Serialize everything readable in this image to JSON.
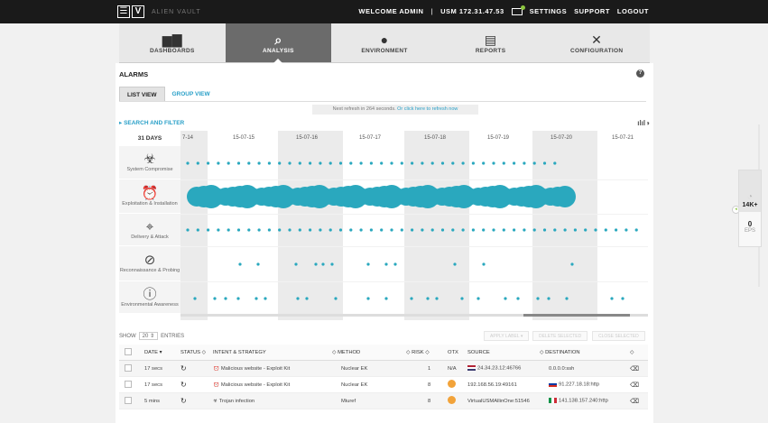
{
  "app": {
    "logo_text": "V",
    "brand": "ALIEN VAULT",
    "welcome": "WELCOME ADMIN",
    "separator": "|",
    "usm": "USM 172.31.47.53",
    "links": [
      "SETTINGS",
      "SUPPORT",
      "LOGOUT"
    ]
  },
  "mainnav": [
    {
      "label": "DASHBOARDS",
      "icon": "bar-chart-icon",
      "glyph": "▆▇"
    },
    {
      "label": "ANALYSIS",
      "icon": "magnify-icon",
      "glyph": "⌕",
      "active": true
    },
    {
      "label": "ENVIRONMENT",
      "icon": "planet-icon",
      "glyph": "●"
    },
    {
      "label": "REPORTS",
      "icon": "document-icon",
      "glyph": "▤"
    },
    {
      "label": "CONFIGURATION",
      "icon": "tools-icon",
      "glyph": "✕"
    }
  ],
  "page": {
    "title": "ALARMS",
    "help": "?",
    "tabs": [
      "LIST VIEW",
      "GROUP VIEW"
    ],
    "refresh_text": "Next refresh in 264 seconds.",
    "refresh_link": "Or click here to refresh now",
    "search_filter": "▸ SEARCH AND FILTER",
    "chart_icon": "ılıl◑"
  },
  "timeline": {
    "days": "31 DAYS",
    "dates": [
      "7-14",
      "15-07-15",
      "15-07-16",
      "15-07-17",
      "15-07-18",
      "15-07-19",
      "15-07-20",
      "15-07-21"
    ],
    "categories": [
      {
        "label": "System Compromise",
        "icon": "biohazard-icon",
        "glyph": "☣"
      },
      {
        "label": "Exploitation & Installation",
        "icon": "alarm-clock-icon",
        "glyph": "⏰"
      },
      {
        "label": "Delivery & Attack",
        "icon": "crosshair-icon",
        "glyph": "⌖"
      },
      {
        "label": "Reconnaissance & Probing",
        "icon": "compass-icon",
        "glyph": "⊘"
      },
      {
        "label": "Environmental Awareness",
        "icon": "info-icon",
        "glyph": "ⓘ"
      }
    ],
    "dot_color": "#2aa8be"
  },
  "table": {
    "show_label": "SHOW",
    "show_value": "20",
    "entries_label": "ENTRIES",
    "actions": [
      "APPLY LABEL",
      "DELETE SELECTED",
      "CLOSE SELECTED"
    ],
    "headers": [
      "DATE",
      "STATUS",
      "INTENT & STRATEGY",
      "METHOD",
      "RISK",
      "OTX",
      "SOURCE",
      "DESTINATION"
    ],
    "rows": [
      {
        "date": "17 secs",
        "intent": "Malicious website - Exploit Kit",
        "method": "Nuclear EK",
        "risk": "1",
        "otx": "N/A",
        "source": "24.34.23.12:46766",
        "source_flag": "us",
        "destination": "0.0.0.0:ssh",
        "dest_flag": ""
      },
      {
        "date": "17 secs",
        "intent": "Malicious website - Exploit Kit",
        "method": "Nuclear EK",
        "risk": "8",
        "otx": "icon",
        "source": "192.168.56.19:49161",
        "source_flag": "",
        "destination": "91.227.18.18:http",
        "dest_flag": "ru"
      },
      {
        "date": "5 mins",
        "intent": "Trojan infection",
        "method": "Miuref",
        "risk": "8",
        "otx": "icon",
        "source": "VirtualUSMAllinOne:51546",
        "source_flag": "",
        "destination": "141.138.157.240:http",
        "dest_flag": "it"
      }
    ]
  },
  "sidepanel": {
    "top_value": "14K+",
    "bottom_value": "0",
    "bottom_label": "EPS"
  }
}
